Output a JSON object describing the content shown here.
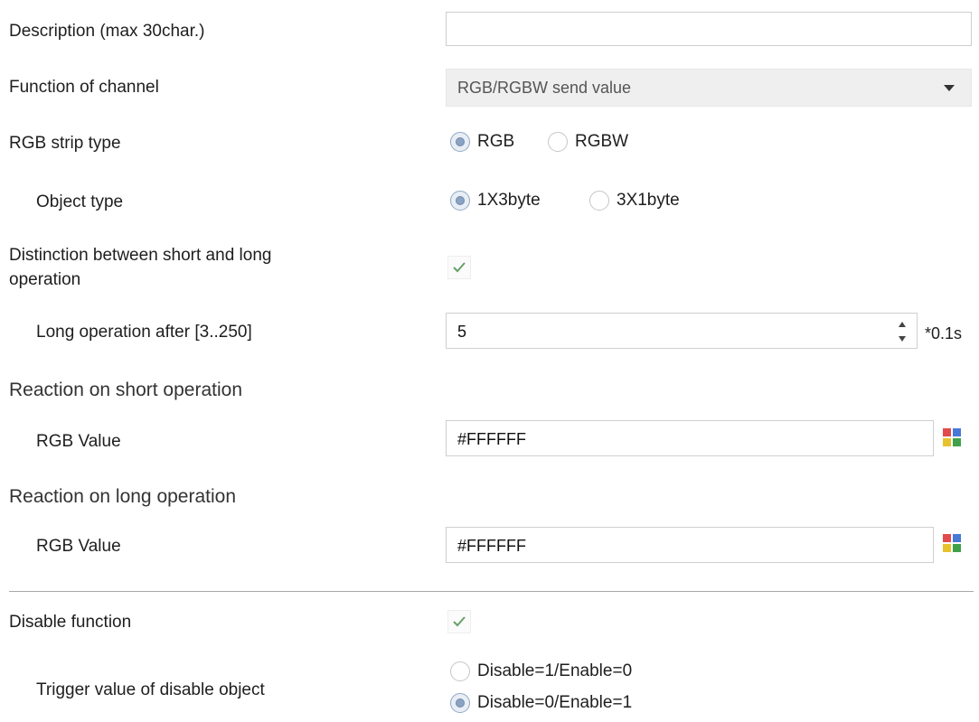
{
  "description": {
    "label": "Description (max 30char.)",
    "value": ""
  },
  "function_of_channel": {
    "label": "Function of channel",
    "value": "RGB/RGBW send value"
  },
  "rgb_strip_type": {
    "label": "RGB strip type",
    "options": [
      {
        "label": "RGB",
        "selected": true
      },
      {
        "label": "RGBW",
        "selected": false
      }
    ]
  },
  "object_type": {
    "label": "Object type",
    "options": [
      {
        "label": "1X3byte",
        "selected": true
      },
      {
        "label": "3X1byte",
        "selected": false
      }
    ]
  },
  "distinction": {
    "label_line1": "Distinction between short and long",
    "label_line2": "operation",
    "checked": true
  },
  "long_operation": {
    "label": "Long operation after [3..250]",
    "value": "5",
    "unit": "*0.1s"
  },
  "short_section": {
    "title": "Reaction on short operation",
    "rgb_label": "RGB Value",
    "rgb_value": "#FFFFFF"
  },
  "long_section": {
    "title": "Reaction on long operation",
    "rgb_label": "RGB Value",
    "rgb_value": "#FFFFFF"
  },
  "disable_function": {
    "label": "Disable function",
    "checked": true
  },
  "trigger_value": {
    "label": "Trigger value of disable object",
    "options": [
      {
        "label": "Disable=1/Enable=0",
        "selected": false
      },
      {
        "label": "Disable=0/Enable=1",
        "selected": true
      }
    ]
  },
  "colors": {
    "check": "#66a266",
    "picker": [
      "#e14b4b",
      "#4a78d6",
      "#e8c22d",
      "#3fa24a"
    ]
  },
  "icons": {
    "dropdown": "chevron-down-icon",
    "picker": "color-picker-icon",
    "spinner": "spinner-arrows-icon"
  }
}
